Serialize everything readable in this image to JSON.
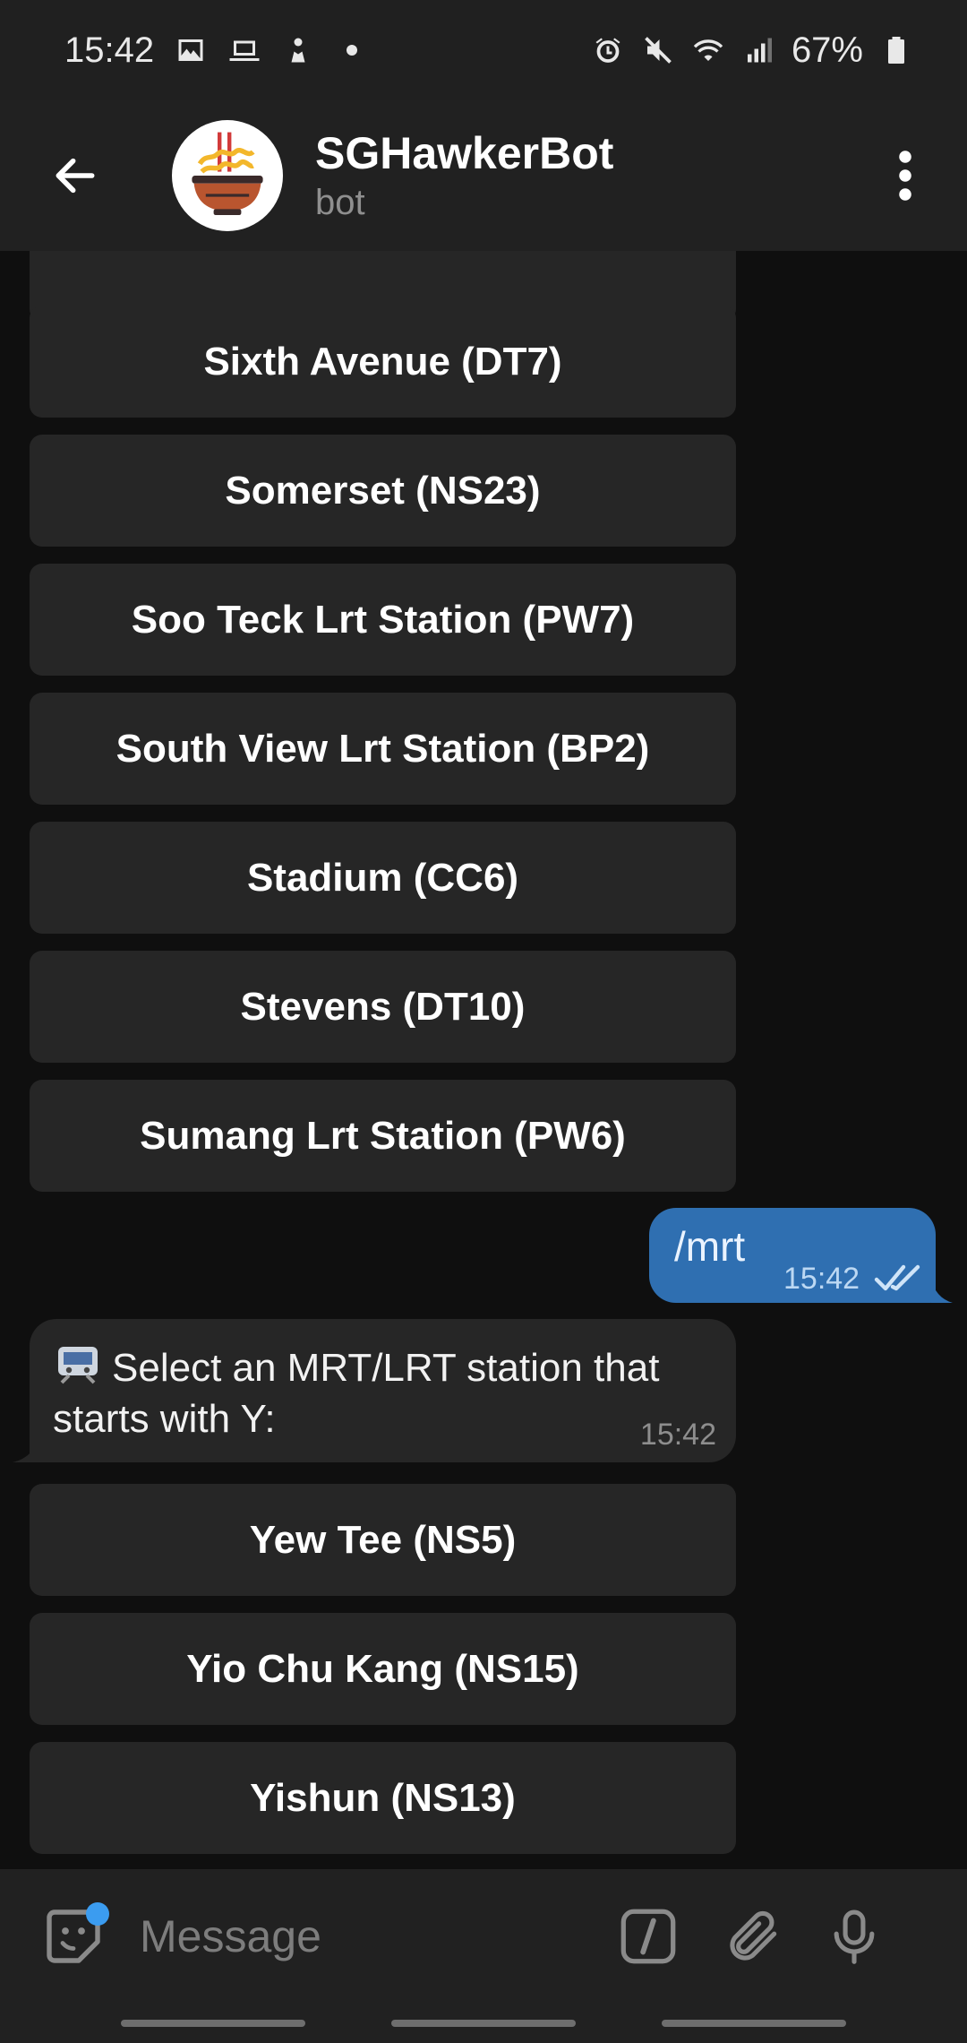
{
  "status_bar": {
    "time": "15:42",
    "battery": "67%",
    "left_icons": [
      "gallery-icon",
      "laptop-icon",
      "figure-icon",
      "dot-icon"
    ],
    "right_icons": [
      "alarm-icon",
      "mute-icon",
      "wifi-icon",
      "signal-icon",
      "battery-icon"
    ]
  },
  "header": {
    "title": "SGHawkerBot",
    "subtitle": "bot"
  },
  "chat": {
    "keyboard_top": [
      "Sixth Avenue (DT7)",
      "Somerset (NS23)",
      "Soo Teck Lrt Station (PW7)",
      "South View Lrt Station (BP2)",
      "Stadium (CC6)",
      "Stevens (DT10)",
      "Sumang Lrt Station (PW6)"
    ],
    "outgoing": {
      "text": "/mrt",
      "time": "15:42"
    },
    "incoming": {
      "text": "Select an MRT/LRT station that starts with Y:",
      "time": "15:42"
    },
    "keyboard_bottom": [
      "Yew Tee (NS5)",
      "Yio Chu Kang (NS15)",
      "Yishun (NS13)"
    ]
  },
  "input": {
    "placeholder": "Message"
  },
  "colors": {
    "outgoing_bubble": "#2f6fb1",
    "background": "#0f0f0f",
    "header": "#212121",
    "keyboard_button": "#262626",
    "badge": "#3b9cf0"
  }
}
